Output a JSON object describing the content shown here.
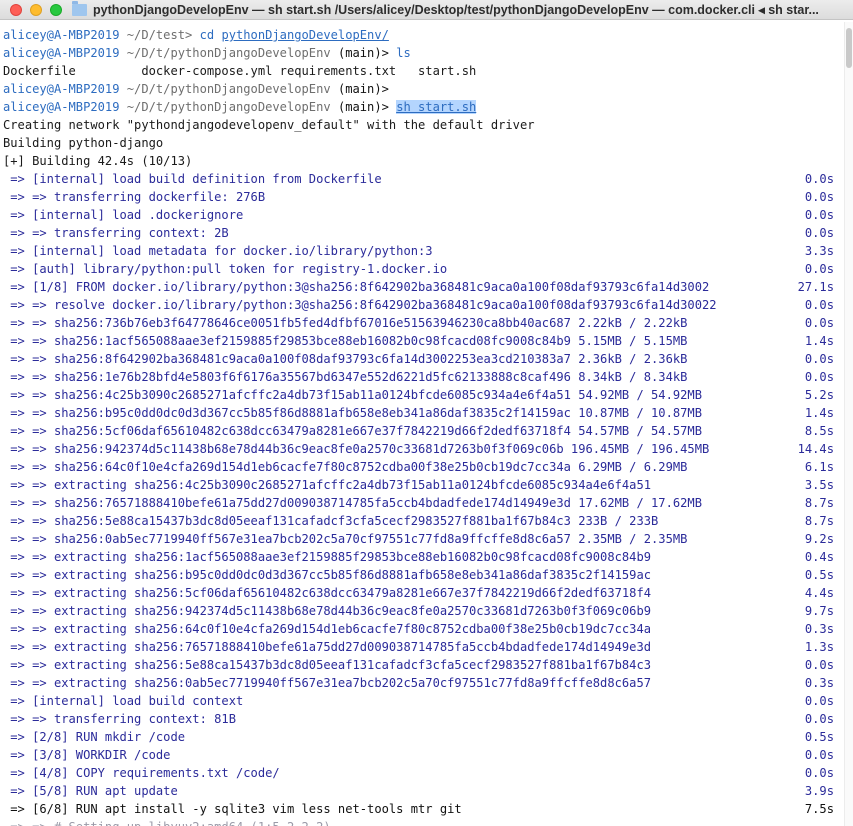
{
  "window": {
    "title": "pythonDjangoDevelopEnv — sh start.sh  /Users/alicey/Desktop/test/pythonDjangoDevelopEnv — com.docker.cli ◂ sh star..."
  },
  "prompts": [
    {
      "user": "alicey@A-MBP2019",
      "path": "~/D/test>",
      "branch": "",
      "cmd": "cd",
      "arg": "pythonDjangoDevelopEnv/"
    },
    {
      "user": "alicey@A-MBP2019",
      "path": "~/D/t/pythonDjangoDevelopEnv",
      "branch": "(main)>",
      "cmd": "ls",
      "arg": ""
    },
    {
      "user": "alicey@A-MBP2019",
      "path": "~/D/t/pythonDjangoDevelopEnv",
      "branch": "(main)>",
      "cmd": "",
      "arg": ""
    },
    {
      "user": "alicey@A-MBP2019",
      "path": "~/D/t/pythonDjangoDevelopEnv",
      "branch": "(main)>",
      "cmd": "sh start.sh",
      "arg": ""
    }
  ],
  "ls_output": "Dockerfile         docker-compose.yml requirements.txt   start.sh",
  "output": {
    "creating": "Creating network \"pythondjangodevelopenv_default\" with the default driver",
    "building": "Building python-django",
    "progress": "[+] Building 42.4s (10/13)"
  },
  "build_lines": [
    {
      "text": " => [internal] load build definition from Dockerfile",
      "time": "0.0s"
    },
    {
      "text": " => => transferring dockerfile: 276B",
      "time": "0.0s"
    },
    {
      "text": " => [internal] load .dockerignore",
      "time": "0.0s"
    },
    {
      "text": " => => transferring context: 2B",
      "time": "0.0s"
    },
    {
      "text": " => [internal] load metadata for docker.io/library/python:3",
      "time": "3.3s"
    },
    {
      "text": " => [auth] library/python:pull token for registry-1.docker.io",
      "time": "0.0s"
    },
    {
      "text": " => [1/8] FROM docker.io/library/python:3@sha256:8f642902ba368481c9aca0a100f08daf93793c6fa14d3002",
      "time": "27.1s"
    },
    {
      "text": " => => resolve docker.io/library/python:3@sha256:8f642902ba368481c9aca0a100f08daf93793c6fa14d30022",
      "time": "0.0s"
    },
    {
      "text": " => => sha256:736b76eb3f64778646ce0051fb5fed4dfbf67016e51563946230ca8bb40ac687 2.22kB / 2.22kB",
      "time": "0.0s"
    },
    {
      "text": " => => sha256:1acf565088aae3ef2159885f29853bce88eb16082b0c98fcacd08fc9008c84b9 5.15MB / 5.15MB",
      "time": "1.4s"
    },
    {
      "text": " => => sha256:8f642902ba368481c9aca0a100f08daf93793c6fa14d3002253ea3cd210383a7 2.36kB / 2.36kB",
      "time": "0.0s"
    },
    {
      "text": " => => sha256:1e76b28bfd4e5803f6f6176a35567bd6347e552d6221d5fc62133888c8caf496 8.34kB / 8.34kB",
      "time": "0.0s"
    },
    {
      "text": " => => sha256:4c25b3090c2685271afcffc2a4db73f15ab11a0124bfcde6085c934a4e6f4a51 54.92MB / 54.92MB",
      "time": "5.2s"
    },
    {
      "text": " => => sha256:b95c0dd0dc0d3d367cc5b85f86d8881afb658e8eb341a86daf3835c2f14159ac 10.87MB / 10.87MB",
      "time": "1.4s"
    },
    {
      "text": " => => sha256:5cf06daf65610482c638dcc63479a8281e667e37f7842219d66f2dedf63718f4 54.57MB / 54.57MB",
      "time": "8.5s"
    },
    {
      "text": " => => sha256:942374d5c11438b68e78d44b36c9eac8fe0a2570c33681d7263b0f3f069c06b 196.45MB / 196.45MB",
      "time": "14.4s"
    },
    {
      "text": " => => sha256:64c0f10e4cfa269d154d1eb6cacfe7f80c8752cdba00f38e25b0cb19dc7cc34a 6.29MB / 6.29MB",
      "time": "6.1s"
    },
    {
      "text": " => => extracting sha256:4c25b3090c2685271afcffc2a4db73f15ab11a0124bfcde6085c934a4e6f4a51",
      "time": "3.5s"
    },
    {
      "text": " => => sha256:76571888410befe61a75dd27d009038714785fa5ccb4bdadfede174d14949e3d 17.62MB / 17.62MB",
      "time": "8.7s"
    },
    {
      "text": " => => sha256:5e88ca15437b3dc8d05eeaf131cafadcf3cfa5cecf2983527f881ba1f67b84c3 233B / 233B",
      "time": "8.7s"
    },
    {
      "text": " => => sha256:0ab5ec7719940ff567e31ea7bcb202c5a70cf97551c77fd8a9ffcffe8d8c6a57 2.35MB / 2.35MB",
      "time": "9.2s"
    },
    {
      "text": " => => extracting sha256:1acf565088aae3ef2159885f29853bce88eb16082b0c98fcacd08fc9008c84b9",
      "time": "0.4s"
    },
    {
      "text": " => => extracting sha256:b95c0dd0dc0d3d367cc5b85f86d8881afb658e8eb341a86daf3835c2f14159ac",
      "time": "0.5s"
    },
    {
      "text": " => => extracting sha256:5cf06daf65610482c638dcc63479a8281e667e37f7842219d66f2dedf63718f4",
      "time": "4.4s"
    },
    {
      "text": " => => extracting sha256:942374d5c11438b68e78d44b36c9eac8fe0a2570c33681d7263b0f3f069c06b9",
      "time": "9.7s"
    },
    {
      "text": " => => extracting sha256:64c0f10e4cfa269d154d1eb6cacfe7f80c8752cdba00f38e25b0cb19dc7cc34a",
      "time": "0.3s"
    },
    {
      "text": " => => extracting sha256:76571888410befe61a75dd27d009038714785fa5ccb4bdadfede174d14949e3d",
      "time": "1.3s"
    },
    {
      "text": " => => extracting sha256:5e88ca15437b3dc8d05eeaf131cafadcf3cfa5cecf2983527f881ba1f67b84c3",
      "time": "0.0s"
    },
    {
      "text": " => => extracting sha256:0ab5ec7719940ff567e31ea7bcb202c5a70cf97551c77fd8a9ffcffe8d8c6a57",
      "time": "0.3s"
    },
    {
      "text": " => [internal] load build context",
      "time": "0.0s"
    },
    {
      "text": " => => transferring context: 81B",
      "time": "0.0s"
    },
    {
      "text": " => [2/8] RUN mkdir /code",
      "time": "0.5s"
    },
    {
      "text": " => [3/8] WORKDIR /code",
      "time": "0.0s"
    },
    {
      "text": " => [4/8] COPY requirements.txt /code/",
      "time": "0.0s"
    },
    {
      "text": " => [5/8] RUN apt update",
      "time": "3.9s"
    }
  ],
  "active_line": {
    "text": " => [6/8] RUN apt install -y sqlite3 vim less net-tools mtr git",
    "time": "7.5s"
  },
  "faded_line": " => => # Setting up libyuv2:amd64 (1:5.2.2.2)"
}
